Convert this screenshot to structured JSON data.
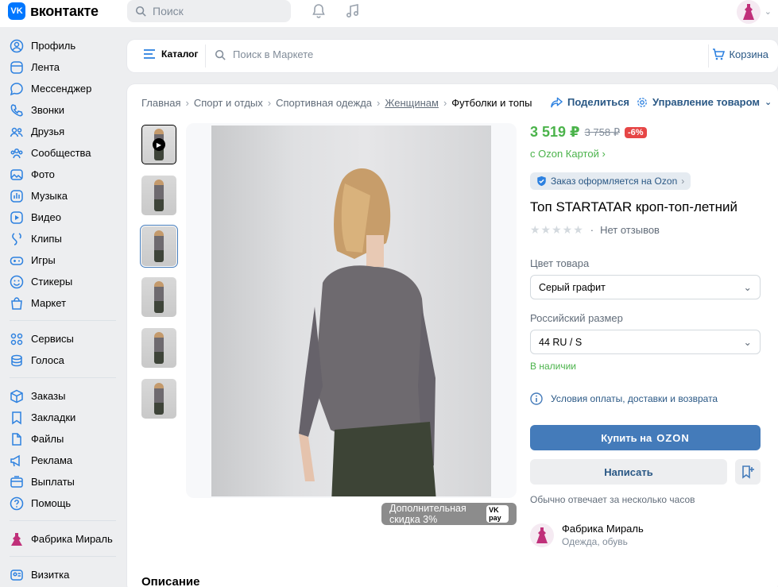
{
  "header": {
    "logo_text": "вконтакте",
    "search_placeholder": "Поиск"
  },
  "sidebar": {
    "group1": [
      {
        "label": "Профиль",
        "icon": "profile-icon"
      },
      {
        "label": "Лента",
        "icon": "feed-icon"
      },
      {
        "label": "Мессенджер",
        "icon": "messenger-icon"
      },
      {
        "label": "Звонки",
        "icon": "phone-icon"
      },
      {
        "label": "Друзья",
        "icon": "friends-icon"
      },
      {
        "label": "Сообщества",
        "icon": "communities-icon"
      },
      {
        "label": "Фото",
        "icon": "photo-icon"
      },
      {
        "label": "Музыка",
        "icon": "music-icon"
      },
      {
        "label": "Видео",
        "icon": "video-icon"
      },
      {
        "label": "Клипы",
        "icon": "clips-icon"
      },
      {
        "label": "Игры",
        "icon": "games-icon"
      },
      {
        "label": "Стикеры",
        "icon": "stickers-icon"
      },
      {
        "label": "Маркет",
        "icon": "market-icon"
      }
    ],
    "group2": [
      {
        "label": "Сервисы",
        "icon": "services-icon"
      },
      {
        "label": "Голоса",
        "icon": "votes-icon"
      }
    ],
    "group3": [
      {
        "label": "Заказы",
        "icon": "orders-icon"
      },
      {
        "label": "Закладки",
        "icon": "bookmarks-icon"
      },
      {
        "label": "Файлы",
        "icon": "files-icon"
      },
      {
        "label": "Реклама",
        "icon": "ads-icon"
      },
      {
        "label": "Выплаты",
        "icon": "payouts-icon"
      },
      {
        "label": "Помощь",
        "icon": "help-icon"
      }
    ],
    "group4": [
      {
        "label": "Фабрика Мираль",
        "icon": "community-avatar"
      }
    ],
    "group5": [
      {
        "label": "Визитка",
        "icon": "card-icon"
      }
    ]
  },
  "market_bar": {
    "catalog_label": "Каталог",
    "search_placeholder": "Поиск в Маркете",
    "cart_label": "Корзина"
  },
  "breadcrumb": [
    "Главная",
    "Спорт и отдых",
    "Спортивная одежда",
    "Женщинам",
    "Футболки и топы"
  ],
  "actions": {
    "share": "Поделиться",
    "manage": "Управление товаром"
  },
  "photo": {
    "discount_text": "Дополнительная скидка 3%",
    "pay_label": "pay"
  },
  "product": {
    "price": "3 519 ₽",
    "old_price": "3 758 ₽",
    "discount": "-6%",
    "card_note": "с Ozon Картой",
    "order_badge": "Заказ оформляется на Ozon",
    "title": "Топ STARTATAR кроп-топ-летний",
    "reviews": "Нет отзывов",
    "color_label": "Цвет товара",
    "color_value": "Серый графит",
    "size_label": "Российский размер",
    "size_value": "44 RU / S",
    "stock": "В наличии",
    "conditions": "Условия оплаты, доставки и возврата",
    "buy_prefix": "Купить на",
    "buy_brand": "OZON",
    "write_label": "Написать",
    "reply_note": "Обычно отвечает за несколько часов"
  },
  "seller": {
    "name": "Фабрика Мираль",
    "category": "Одежда, обувь"
  },
  "section": {
    "description": "Описание"
  },
  "colors": {
    "vk_blue": "#0077ff",
    "button_blue": "#447bba",
    "price_green": "#4bb34b",
    "discount_red": "#e64646"
  }
}
